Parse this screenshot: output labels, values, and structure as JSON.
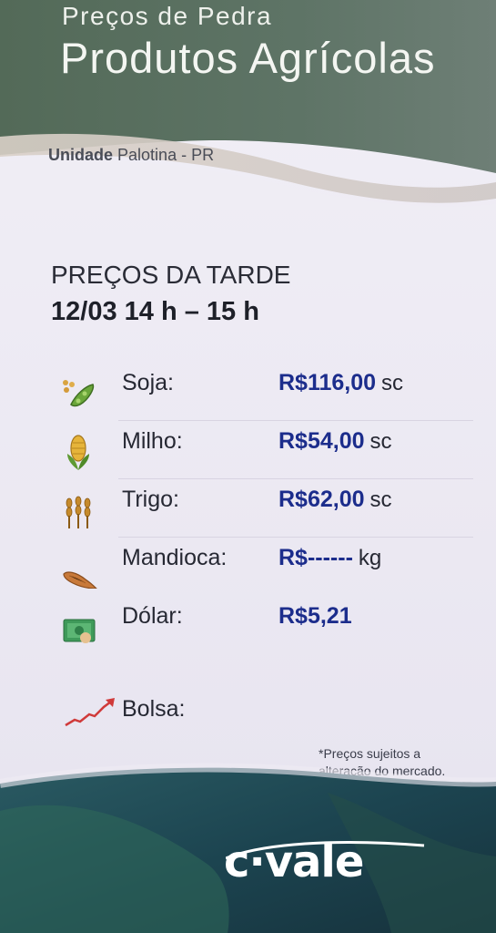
{
  "header": {
    "subtitle": "Preços de Pedra",
    "title": "Produtos Agrícolas",
    "unit_prefix": "Unidade",
    "unit_name": "Palotina - PR"
  },
  "session": {
    "title": "PREÇOS DA  TARDE",
    "datetime": "12/03  14 h – 15 h"
  },
  "prices": [
    {
      "icon": "soybean-icon",
      "label": "Soja:",
      "value": "R$116,00",
      "unit": "sc"
    },
    {
      "icon": "corn-icon",
      "label": "Milho:",
      "value": "R$54,00",
      "unit": "sc"
    },
    {
      "icon": "wheat-icon",
      "label": "Trigo:",
      "value": "R$62,00",
      "unit": "sc"
    },
    {
      "icon": "cassava-icon",
      "label": "Mandioca:",
      "value": "R$------",
      "unit": "kg"
    },
    {
      "icon": "dollar-bill-icon",
      "label": "Dólar:",
      "value": "R$5,21",
      "unit": ""
    },
    {
      "icon": "stock-chart-icon",
      "label": "Bolsa:",
      "value": "",
      "unit": ""
    }
  ],
  "disclaimer": {
    "line1": "*Preços sujeitos a",
    "line2": "alteração do mercado."
  },
  "footer": {
    "logo_text": "c·vale"
  },
  "colors": {
    "price": "#1c2d8c",
    "header_green": "#4f6a55",
    "footer_teal": "#1f4a55"
  }
}
